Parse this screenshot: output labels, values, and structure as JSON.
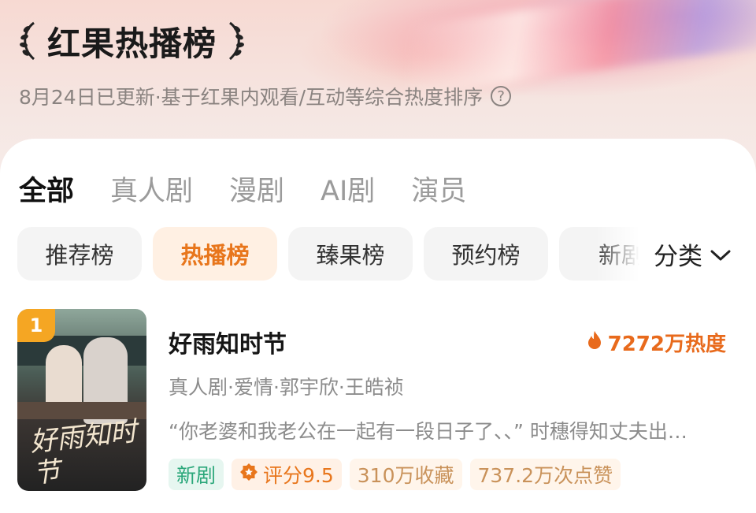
{
  "header": {
    "title": "红果热播榜",
    "subtitle": "8月24日已更新·基于红果内观看/互动等综合热度排序",
    "help_icon": "question-circle-icon"
  },
  "tabs": [
    {
      "label": "全部",
      "active": true
    },
    {
      "label": "真人剧",
      "active": false
    },
    {
      "label": "漫剧",
      "active": false
    },
    {
      "label": "AI剧",
      "active": false
    },
    {
      "label": "演员",
      "active": false
    }
  ],
  "chips": [
    {
      "label": "推荐榜",
      "active": false
    },
    {
      "label": "热播榜",
      "active": true
    },
    {
      "label": "臻果榜",
      "active": false
    },
    {
      "label": "预约榜",
      "active": false
    },
    {
      "label": "新剧",
      "active": false
    }
  ],
  "category": {
    "label": "分类",
    "icon": "chevron-down-icon"
  },
  "items": [
    {
      "rank": "1",
      "title": "好雨知时节",
      "heat": "7272万热度",
      "meta": "真人剧·爱情·郭宇欣·王皓祯",
      "description": "“你老婆和我老公在一起有一段日子了、、” 时穗得知丈夫出…",
      "poster_text": "好雨知时节",
      "tags": {
        "new": "新剧",
        "score": "评分9.5",
        "favorites": "310万收藏",
        "likes": "737.2万次点赞"
      }
    }
  ],
  "colors": {
    "accent": "#e8761c",
    "rank_badge": "#f5a623",
    "new_tag": "#2aa77a"
  }
}
